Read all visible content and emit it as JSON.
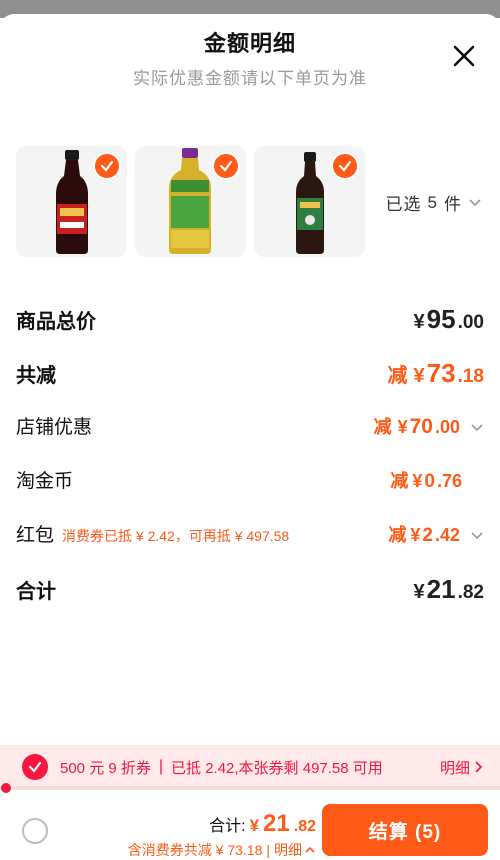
{
  "header": {
    "title": "金额明细",
    "subtitle": "实际优惠金额请以下单页为准"
  },
  "products": {
    "selected_label": "已选",
    "selected_count": "5",
    "selected_unit": "件",
    "items": [
      {
        "name": "蚝油瓶",
        "label_text": "大厨宝"
      },
      {
        "name": "料酒瓶",
        "label_text": "葱姜料酒"
      },
      {
        "name": "酱油瓶",
        "label_text": ""
      }
    ]
  },
  "breakdown": {
    "total_price": {
      "label": "商品总价",
      "currency": "¥",
      "int": "95",
      "dec": ".00"
    },
    "total_discount": {
      "label": "共减",
      "prefix": "减",
      "currency": "¥",
      "int": "73",
      "dec": ".18"
    },
    "store_discount": {
      "label": "店铺优惠",
      "prefix": "减",
      "currency": "¥",
      "int": "70",
      "dec": ".00"
    },
    "taojinbi": {
      "label": "淘金币",
      "prefix": "减",
      "currency": "¥",
      "int": "0",
      "dec": ".76"
    },
    "hongbao": {
      "label": "红包",
      "note": "消费券已抵 ¥ 2.42，可再抵 ¥ 497.58",
      "prefix": "减",
      "currency": "¥",
      "int": "2",
      "dec": ".42"
    },
    "sum": {
      "label": "合计",
      "currency": "¥",
      "int": "21",
      "dec": ".82"
    }
  },
  "coupon": {
    "name": "500 元 9 折券",
    "info": "已抵 2.42,本张券剩 497.58 可用",
    "detail": "明细",
    "progress": 0.005
  },
  "footer": {
    "total_label": "合计:",
    "currency": "¥",
    "int": "21",
    "dec": ".82",
    "sub_text": "含消费券共减 ¥ 73.18",
    "sub_detail": "明细",
    "checkout": "结算 (5)"
  },
  "colors": {
    "accent": "#ff5a17",
    "coupon_red": "#f5173f",
    "coupon_bg": "#ffe9ea"
  }
}
